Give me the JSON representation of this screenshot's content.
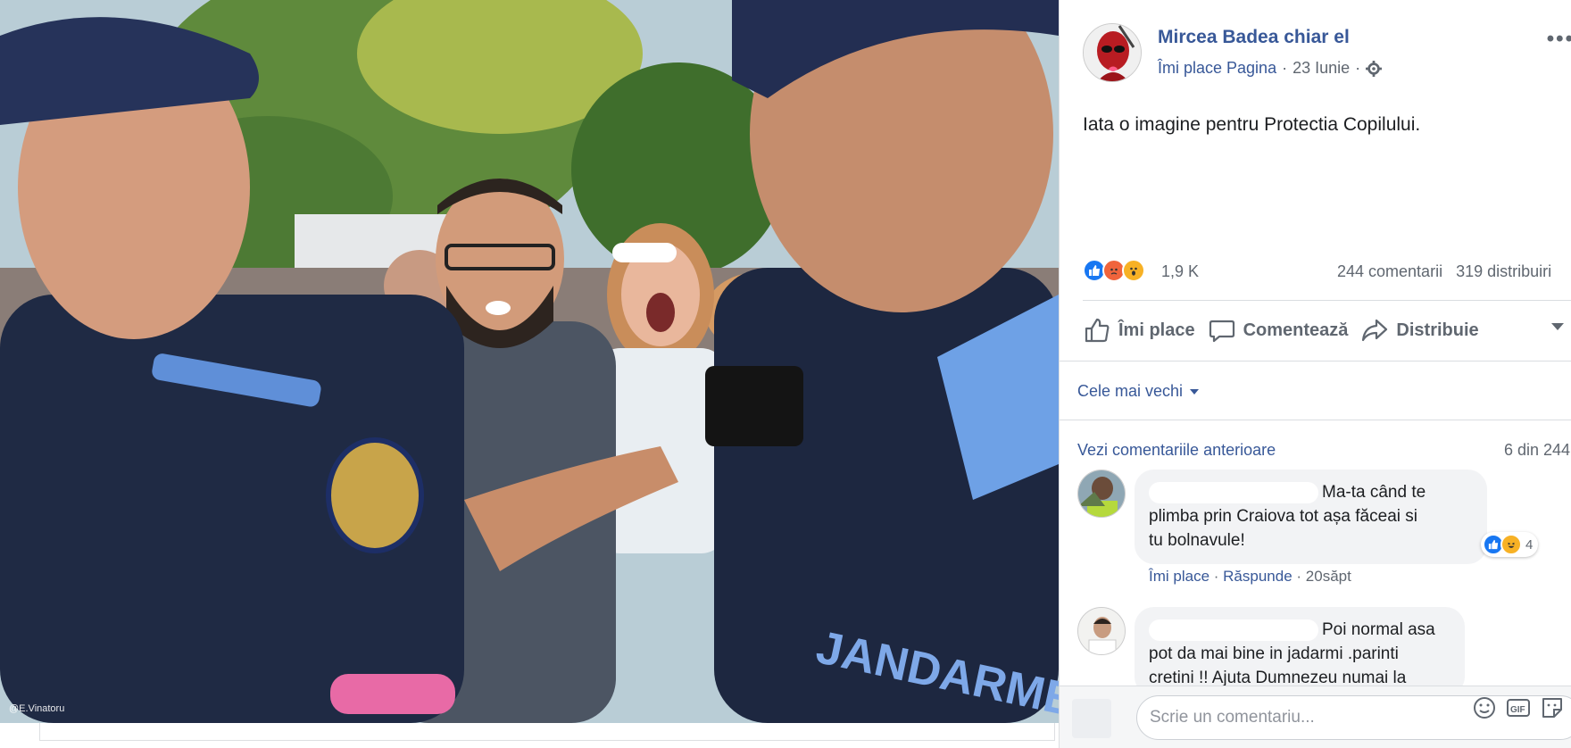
{
  "photo": {
    "credit": "@E.Vinatoru",
    "badge_text": "JANDARMERIE"
  },
  "post": {
    "page_name": "Mircea Badea chiar el",
    "like_page": "Îmi place Pagina",
    "date": "23 Iunie",
    "more": "•••",
    "text": "Iata o imagine pentru Protectia Copilului.",
    "reaction_count": "1,9 K",
    "comments_count": "244 comentarii",
    "shares_count": "319 distribuiri"
  },
  "actions": {
    "like": "Îmi place",
    "comment": "Comentează",
    "share": "Distribuie"
  },
  "comments_section": {
    "sort_label": "Cele mai vechi",
    "view_previous": "Vezi comentariile anterioare",
    "progress": "6 din 244",
    "items": [
      {
        "text": "Ma-ta când te plimba prin Craiova tot așa făceai si tu bolnavule!",
        "line1": "Ma-ta când te",
        "line2": "plimba prin Craiova tot așa făceai si",
        "line3": "tu bolnavule!",
        "reactions": "4",
        "like": "Îmi place",
        "reply": "Răspunde",
        "time": "20săpt"
      },
      {
        "text": "Poi normal asa pot da mai bine in jadarmi .parinti cretini !! Ajuta Dumnezeu numai la",
        "line1": "Poi normal asa",
        "line2": "pot da mai bine in jadarmi .parinti",
        "line3": "cretini !! Ajuta Dumnezeu numai la"
      }
    ],
    "input_placeholder": "Scrie un comentariu..."
  },
  "colors": {
    "link": "#385898",
    "like_blue": "#1877f2",
    "angry": "#f0643c",
    "wow": "#f7b125"
  }
}
